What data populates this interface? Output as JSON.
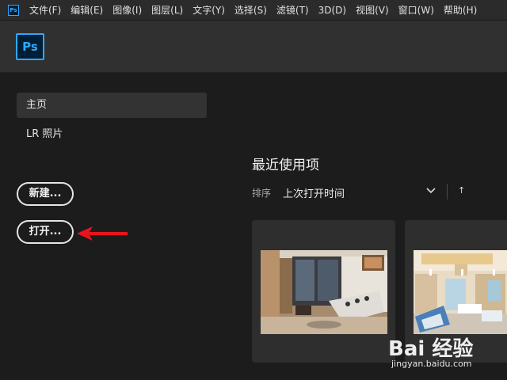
{
  "menubar": {
    "app_icon": "Ps",
    "items": [
      "文件(F)",
      "编辑(E)",
      "图像(I)",
      "图层(L)",
      "文字(Y)",
      "选择(S)",
      "滤镜(T)",
      "3D(D)",
      "视图(V)",
      "窗口(W)",
      "帮助(H)"
    ]
  },
  "appbar": {
    "logo": "Ps"
  },
  "sidebar": {
    "nav": [
      {
        "label": "主页",
        "active": true
      },
      {
        "label": "LR 照片",
        "active": false
      }
    ],
    "new_button": "新建...",
    "open_button": "打开..."
  },
  "annotation": {
    "arrow_color": "#e8141c"
  },
  "recent": {
    "title": "最近使用项",
    "sort_label": "排序",
    "sort_value": "上次打开时间",
    "sort_dir_icon": "↑"
  },
  "colors": {
    "accent": "#31a8ff",
    "background": "#1c1c1c",
    "card": "#2e2e2e"
  },
  "watermark": {
    "logo": "Bai 经验",
    "url": "jingyan.baidu.com"
  }
}
